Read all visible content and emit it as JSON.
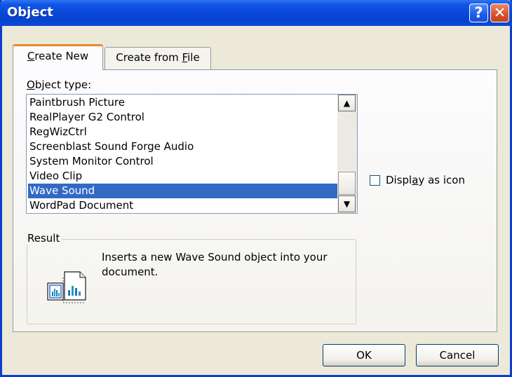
{
  "window": {
    "title": "Object"
  },
  "titlebar": {
    "help_glyph": "?",
    "close_glyph": "✕"
  },
  "tabs": {
    "create_new": {
      "pre": "",
      "key": "C",
      "post": "reate New"
    },
    "create_from_file": {
      "pre": "Create from ",
      "key": "F",
      "post": "ile"
    }
  },
  "object_type": {
    "label": {
      "pre": "",
      "key": "O",
      "post": "bject type:"
    },
    "items": [
      "Paintbrush Picture",
      "RealPlayer G2 Control",
      "RegWizCtrl",
      "Screenblast Sound Forge Audio",
      "System Monitor Control",
      "Video Clip",
      "Wave Sound",
      "WordPad Document"
    ],
    "selected": "Wave Sound",
    "scroll_up_glyph": "▲",
    "scroll_down_glyph": "▼"
  },
  "display_as_icon": {
    "pre": "Displ",
    "key": "a",
    "post": "y as icon",
    "checked": false
  },
  "result": {
    "legend": "Result",
    "text": "Inserts a new Wave Sound object into your document."
  },
  "buttons": {
    "ok": "OK",
    "cancel": "Cancel"
  },
  "colors": {
    "titlebar": "#0a49d9",
    "selection": "#316ac5",
    "dialog_bg": "#ece9d8"
  }
}
